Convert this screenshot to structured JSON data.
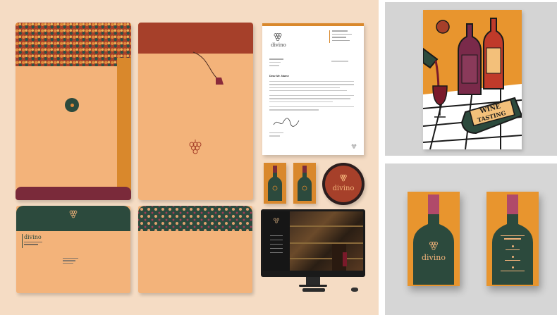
{
  "brand": {
    "name": "divino",
    "colors": {
      "background": "#f5dcc4",
      "peach": "#f3b37a",
      "burgundy": "#7a2a3a",
      "rust": "#a6402a",
      "dark_green": "#2c4a3d",
      "orange": "#d9882c"
    }
  },
  "letterhead": {
    "logo": "divino",
    "salutation": "Dear Mr. Name"
  },
  "envelope": {
    "logo": "divino"
  },
  "coaster": {
    "logo": "divino"
  },
  "business_card": {
    "logo": "divino"
  },
  "poster": {
    "title_line1": "WINE",
    "title_line2": "TASTING"
  },
  "icons": {
    "grape": "grape-cluster-icon",
    "bottle": "wine-bottle-icon",
    "glass": "wine-glass-icon"
  }
}
